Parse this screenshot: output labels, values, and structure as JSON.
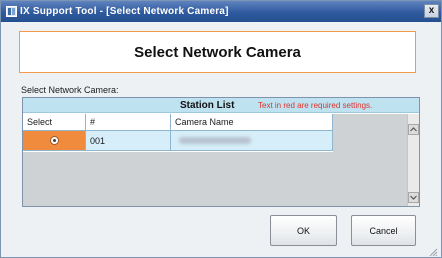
{
  "window": {
    "title": "IX Support Tool - [Select Network Camera]",
    "close_symbol": "x"
  },
  "header": {
    "title": "Select Network Camera"
  },
  "form": {
    "label": "Select Network Camera:"
  },
  "table": {
    "title": "Station List",
    "note": "Text in red are required settings.",
    "columns": [
      "Select",
      "#",
      "Camera Name"
    ],
    "rows": [
      {
        "selected": true,
        "number": "001",
        "camera_name": ""
      }
    ]
  },
  "buttons": {
    "ok": "OK",
    "cancel": "Cancel"
  },
  "colors": {
    "accent_orange": "#f08a3c",
    "header_border": "#f49a4a",
    "title_bar": "#2f5a9f",
    "required_red": "#e0322c"
  }
}
